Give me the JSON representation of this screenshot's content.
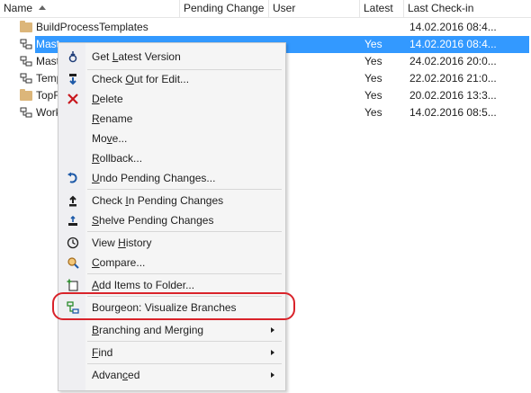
{
  "header": {
    "columns": [
      "Name",
      "Pending Change",
      "User",
      "Latest",
      "Last Check-in"
    ]
  },
  "rows": [
    {
      "name": "BuildProcessTemplates",
      "icon": "folder-icon",
      "latest": "",
      "checkin": "14.02.2016 08:4..."
    },
    {
      "name": "Mast",
      "icon": "branch-icon",
      "latest": "Yes",
      "checkin": "14.02.2016 08:4..."
    },
    {
      "name": "Mast",
      "icon": "branch-icon",
      "latest": "Yes",
      "checkin": "24.02.2016 20:0..."
    },
    {
      "name": "Temp",
      "icon": "branch-icon",
      "latest": "Yes",
      "checkin": "22.02.2016 21:0..."
    },
    {
      "name": "TopF",
      "icon": "folder-icon",
      "latest": "Yes",
      "checkin": "20.02.2016 13:3..."
    },
    {
      "name": "Work",
      "icon": "branch-icon",
      "latest": "Yes",
      "checkin": "14.02.2016 08:5..."
    }
  ],
  "menu": {
    "get_latest": {
      "pre": "Get ",
      "u": "L",
      "post": "atest Version",
      "icon": "get-latest-icon"
    },
    "check_out": {
      "pre": "Check ",
      "u": "O",
      "post": "ut for Edit...",
      "icon": "check-out-icon"
    },
    "delete": {
      "pre": "",
      "u": "D",
      "post": "elete",
      "icon": "delete-icon"
    },
    "rename": {
      "pre": "",
      "u": "R",
      "post": "ename"
    },
    "move": {
      "pre": "Mo",
      "u": "v",
      "post": "e..."
    },
    "rollback": {
      "pre": "",
      "u": "R",
      "post": "ollback..."
    },
    "undo": {
      "pre": "",
      "u": "U",
      "post": "ndo Pending Changes...",
      "icon": "undo-icon"
    },
    "check_in": {
      "pre": "Check ",
      "u": "I",
      "post": "n Pending Changes",
      "icon": "check-in-icon"
    },
    "shelve": {
      "pre": "",
      "u": "S",
      "post": "helve Pending Changes",
      "icon": "shelve-icon"
    },
    "history": {
      "pre": "View ",
      "u": "H",
      "post": "istory",
      "icon": "history-icon"
    },
    "compare": {
      "pre": "",
      "u": "C",
      "post": "ompare...",
      "icon": "compare-icon"
    },
    "add_items": {
      "pre": "",
      "u": "A",
      "post": "dd Items to Folder...",
      "icon": "add-items-icon"
    },
    "bourgeon": {
      "label": "Bourgeon: Visualize Branches",
      "icon": "visualize-branches-icon"
    },
    "branching": {
      "pre": "",
      "u": "B",
      "post": "ranching and Merging"
    },
    "find": {
      "pre": "",
      "u": "F",
      "post": "ind"
    },
    "advanced": {
      "pre": "Advan",
      "u": "c",
      "post": "ed"
    }
  },
  "colors": {
    "selection": "#3399ff",
    "highlight_ring": "#d9232a",
    "menu_bg": "#f5f5f5"
  }
}
